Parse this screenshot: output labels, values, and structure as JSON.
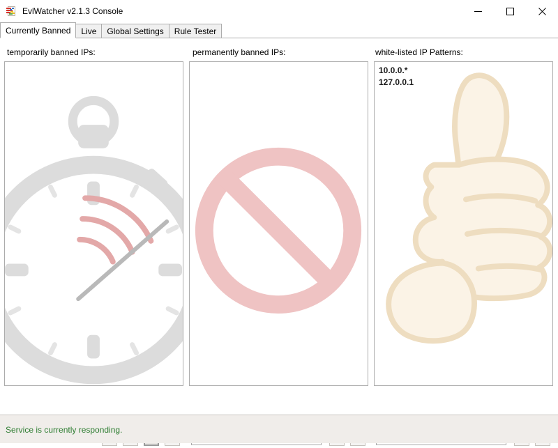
{
  "window": {
    "title": "EvlWatcher v2.1.3 Console",
    "app_icon": "evlwatcher-app-icon",
    "controls": {
      "minimize": "minimize-icon",
      "maximize": "maximize-icon",
      "close": "close-icon"
    }
  },
  "tabs": [
    {
      "label": "Currently Banned",
      "active": true
    },
    {
      "label": "Live",
      "active": false
    },
    {
      "label": "Global Settings",
      "active": false
    },
    {
      "label": "Rule Tester",
      "active": false
    }
  ],
  "panels": {
    "temporary": {
      "label": "temporarily banned IPs:",
      "items": [],
      "watermark": "stopwatch-icon",
      "watermark_colors": {
        "body": "#dcdcdc",
        "accent": "#e7b8b8"
      }
    },
    "permanent": {
      "label": "permanently banned IPs:",
      "items": [],
      "watermark": "no-entry-icon",
      "watermark_colors": {
        "body": "#efc3c3"
      }
    },
    "whitelist": {
      "label": "white-listed IP Patterns:",
      "items": [
        "10.0.0.*",
        "127.0.0.1"
      ],
      "watermark": "thumbs-up-icon",
      "watermark_colors": {
        "fill": "#fbf3e6",
        "stroke": "#eeddc0"
      }
    }
  },
  "toolbar": {
    "temporary_buttons": [
      {
        "name": "delete-temp-ban-button",
        "icon": "red-x-icon",
        "state": "normal"
      },
      {
        "name": "lock-ban-button",
        "icon": "closed-padlock-icon",
        "state": "disabled"
      },
      {
        "name": "permanent-ban-button",
        "icon": "closed-padlock-icon",
        "state": "pressed"
      },
      {
        "name": "unlock-ban-button",
        "icon": "open-padlock-icon",
        "state": "normal"
      }
    ],
    "permanent": {
      "input_value": "",
      "input_placeholder": "",
      "add_button": {
        "name": "add-permanent-ban-button",
        "icon": "green-plus-icon"
      },
      "remove_button": {
        "name": "remove-permanent-ban-button",
        "icon": "red-x-icon"
      }
    },
    "whitelist": {
      "input_value": "",
      "input_placeholder": "",
      "add_button": {
        "name": "add-whitelist-button",
        "icon": "green-plus-icon"
      },
      "remove_button": {
        "name": "remove-whitelist-button",
        "icon": "red-x-icon"
      }
    }
  },
  "statusbar": {
    "message": "Service is currently responding.",
    "color": "#2e7d32"
  }
}
